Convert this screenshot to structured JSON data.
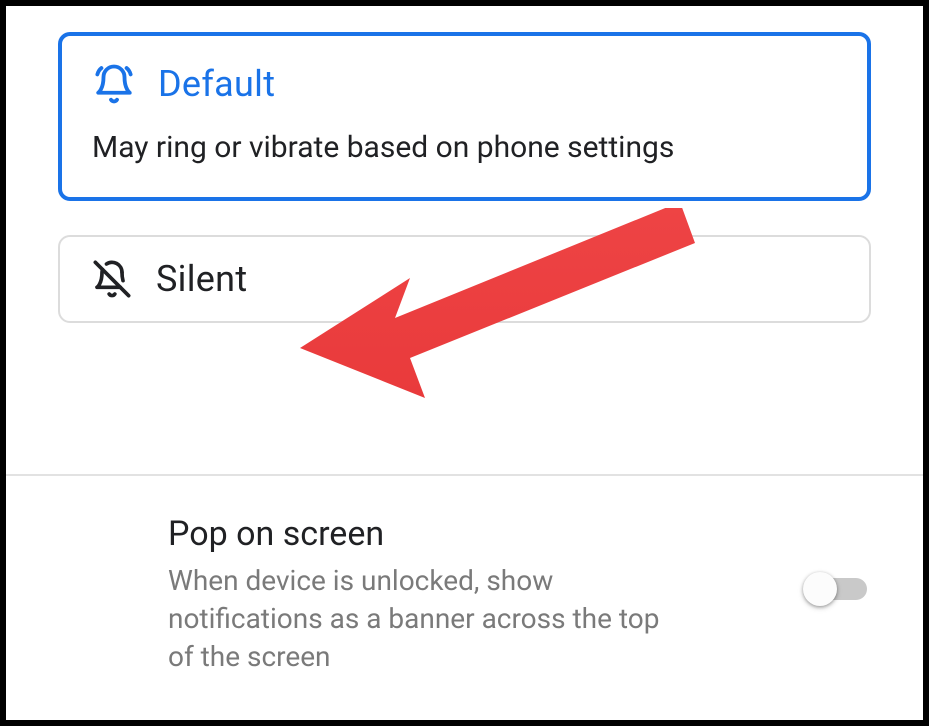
{
  "options": {
    "default": {
      "label": "Default",
      "description": "May ring or vibrate based on phone settings",
      "selected": true
    },
    "silent": {
      "label": "Silent",
      "selected": false
    }
  },
  "pop_on_screen": {
    "title": "Pop on screen",
    "description": "When device is unlocked, show notifications as a banner across the top of the screen",
    "enabled": false
  },
  "colors": {
    "accent": "#1a73e8",
    "annotation": "#ee4445"
  }
}
